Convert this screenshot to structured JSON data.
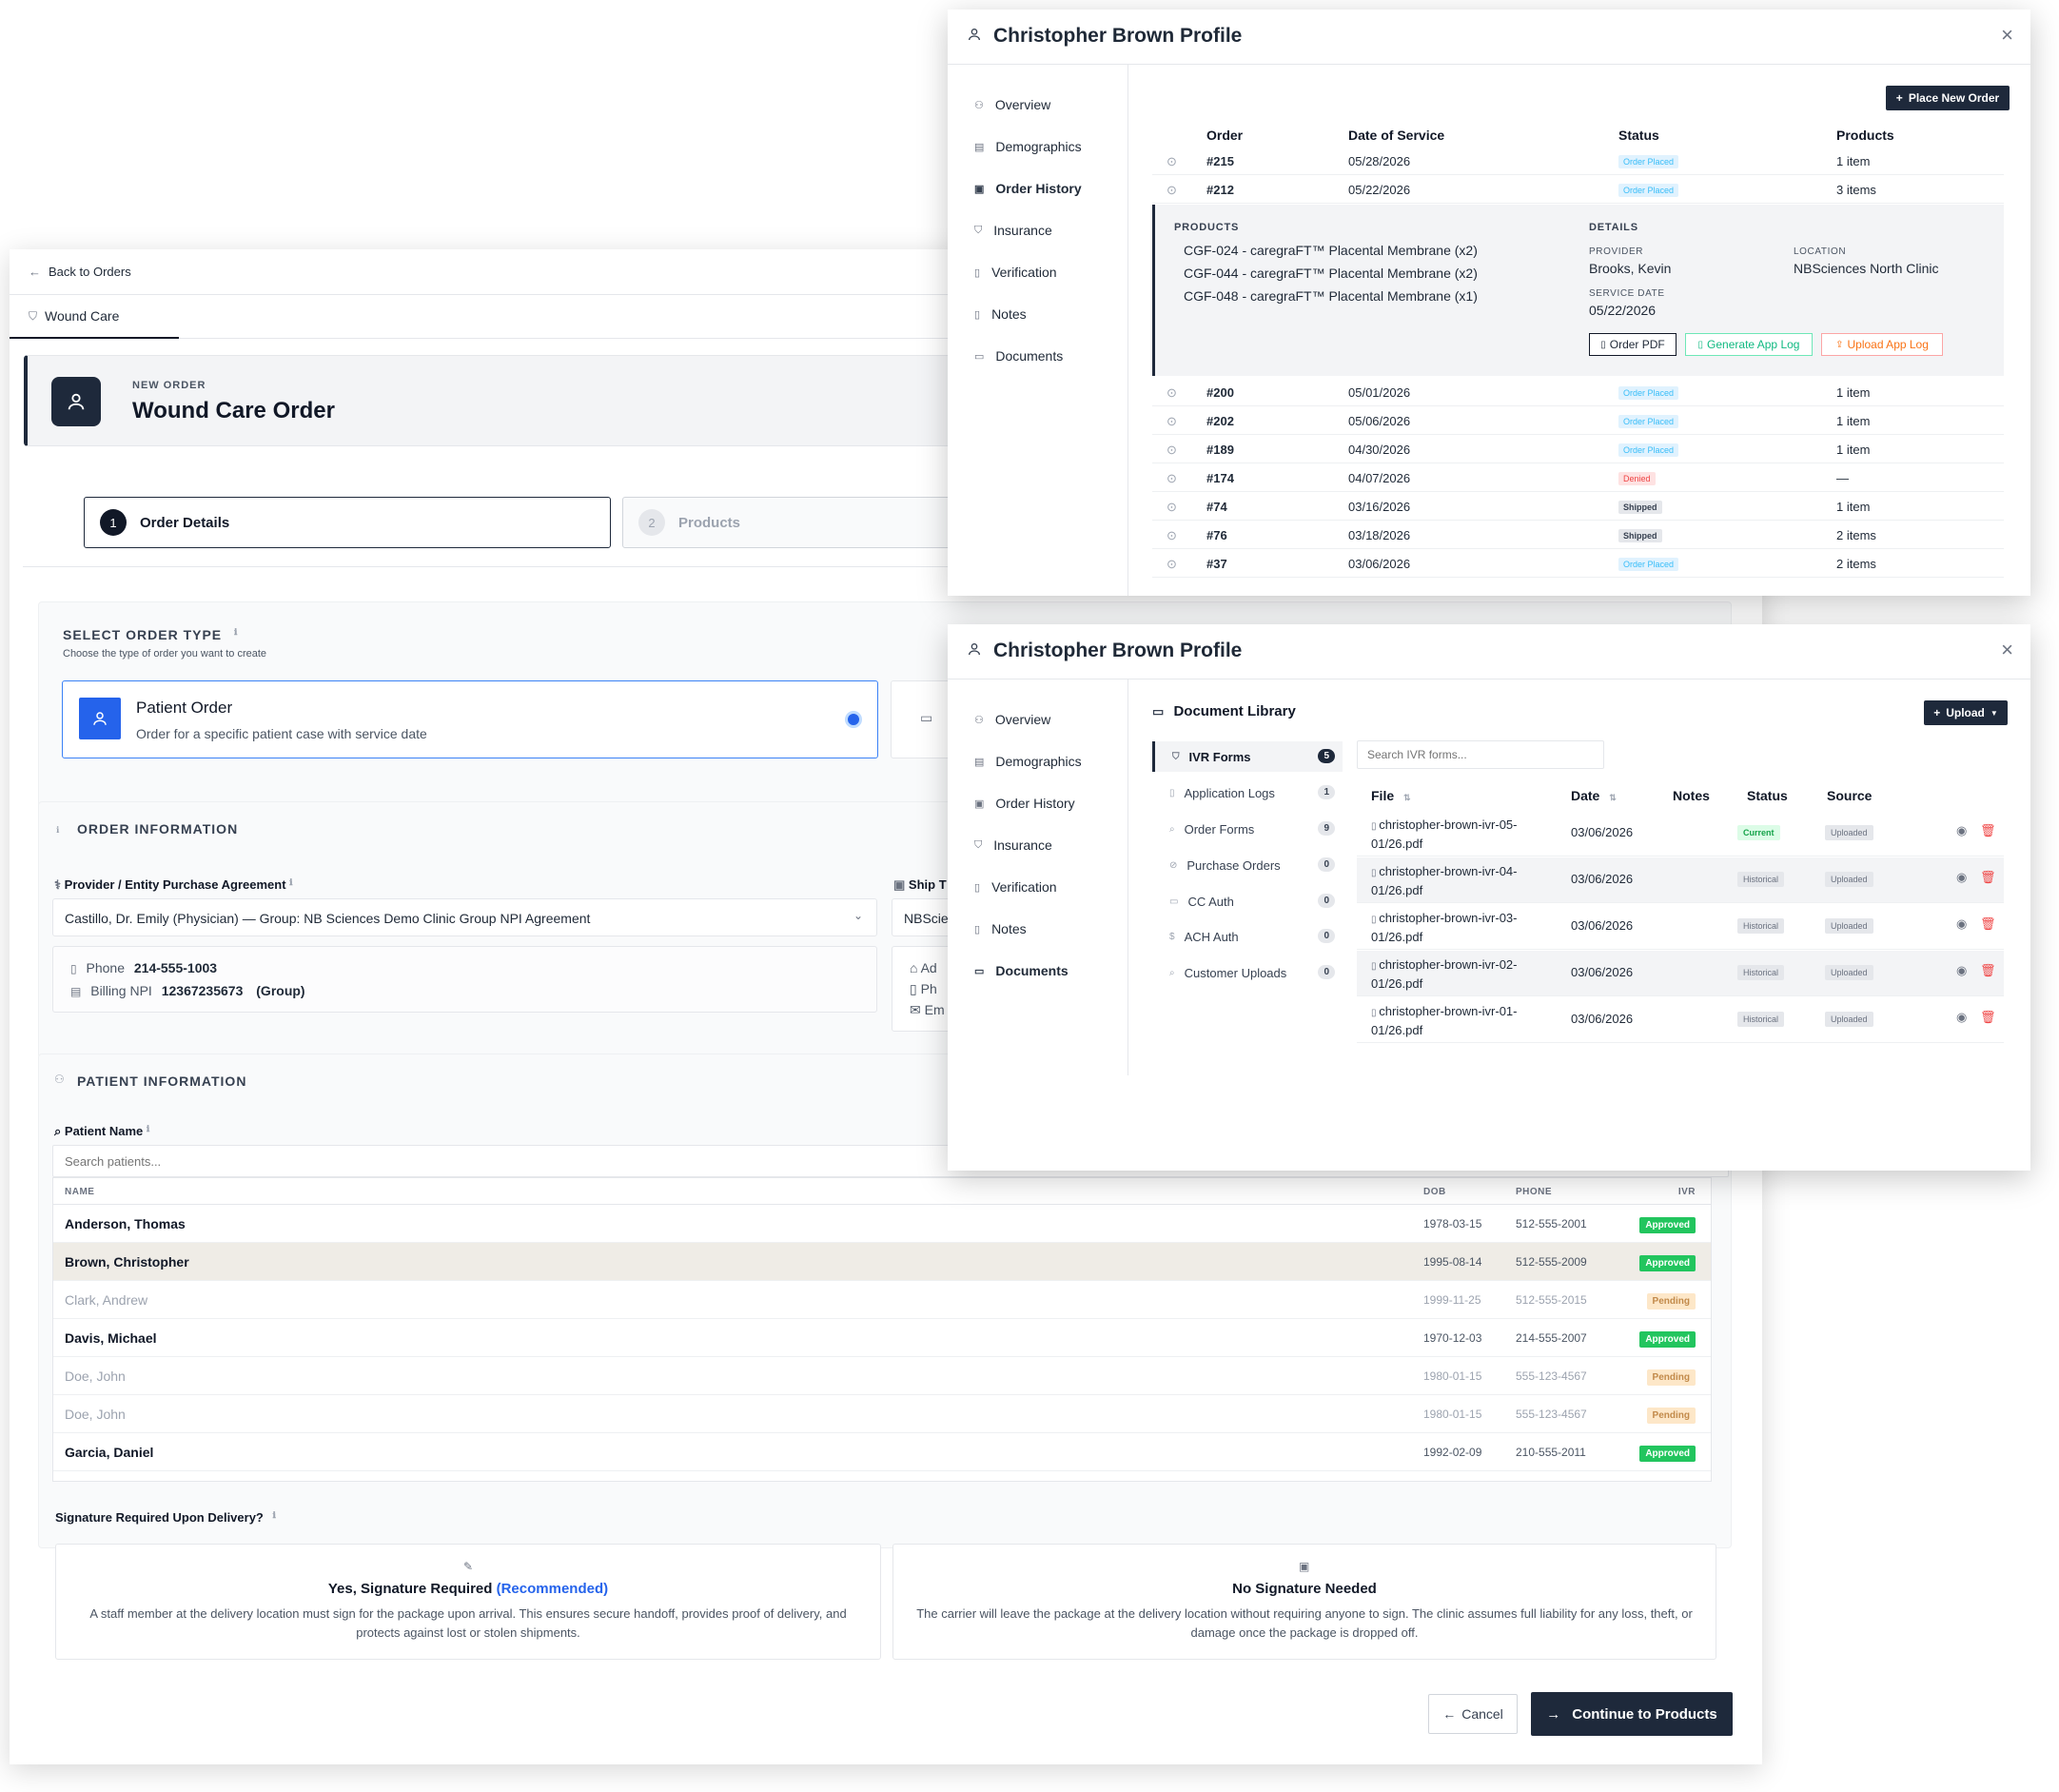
{
  "order_page": {
    "back_label": "Back to Orders",
    "tab_label": "Wound Care",
    "hero": {
      "kicker": "NEW ORDER",
      "title": "Wound Care Order"
    },
    "steps": [
      {
        "num": "1",
        "label": "Order Details"
      },
      {
        "num": "2",
        "label": "Products"
      }
    ],
    "order_type": {
      "heading": "SELECT ORDER TYPE",
      "info": "ℹ",
      "subtitle": "Choose the type of order you want to create",
      "patient_card": {
        "title": "Patient Order",
        "desc": "Order for a specific patient case with service date"
      }
    },
    "order_info": {
      "heading": "ORDER INFORMATION",
      "agreement_label": "Provider / Entity Purchase Agreement",
      "agreement_value": "Castillo, Dr. Emily (Physician) — Group: NB Sciences Demo Clinic Group NPI Agreement",
      "phone_label": "Phone",
      "phone_value": "214-555-1003",
      "npi_label": "Billing NPI",
      "npi_value": "12367235673",
      "npi_type": "(Group)",
      "ship_label": "Ship T",
      "ship_value": "NBScie",
      "ship_lines": [
        "Ad",
        "Ph",
        "Em"
      ]
    },
    "patient_info": {
      "heading": "PATIENT INFORMATION",
      "name_label": "Patient Name",
      "search_placeholder": "Search patients...",
      "columns": {
        "name": "NAME",
        "dob": "DOB",
        "phone": "PHONE",
        "ivr": "IVR"
      },
      "rows": [
        {
          "name": "Anderson, Thomas",
          "dob": "1978-03-15",
          "phone": "512-555-2001",
          "ivr": "Approved"
        },
        {
          "name": "Brown, Christopher",
          "dob": "1995-08-14",
          "phone": "512-555-2009",
          "ivr": "Approved"
        },
        {
          "name": "Clark, Andrew",
          "dob": "1999-11-25",
          "phone": "512-555-2015",
          "ivr": "Pending"
        },
        {
          "name": "Davis, Michael",
          "dob": "1970-12-03",
          "phone": "214-555-2007",
          "ivr": "Approved"
        },
        {
          "name": "Doe, John",
          "dob": "1980-01-15",
          "phone": "555-123-4567",
          "ivr": "Pending"
        },
        {
          "name": "Doe, John",
          "dob": "1980-01-15",
          "phone": "555-123-4567",
          "ivr": "Pending"
        },
        {
          "name": "Garcia, Daniel",
          "dob": "1992-02-09",
          "phone": "210-555-2011",
          "ivr": "Approved"
        }
      ]
    },
    "signature": {
      "question": "Signature Required Upon Delivery?",
      "yes_title": "Yes, Signature Required",
      "yes_tag": "(Recommended)",
      "yes_body": "A staff member at the delivery location must sign for the package upon arrival. This ensures secure handoff, provides proof of delivery, and protects against lost or stolen shipments.",
      "no_title": "No Signature Needed",
      "no_body": "The carrier will leave the package at the delivery location without requiring anyone to sign. The clinic assumes full liability for any loss, theft, or damage once the package is dropped off."
    },
    "actions": {
      "cancel": "Cancel",
      "continue": "Continue to Products"
    }
  },
  "profile_orders": {
    "title": "Christopher Brown Profile",
    "nav": [
      "Overview",
      "Demographics",
      "Order History",
      "Insurance",
      "Verification",
      "Notes",
      "Documents"
    ],
    "place_order": "Place New Order",
    "columns": {
      "order": "Order",
      "date": "Date of Service",
      "status": "Status",
      "products": "Products"
    },
    "rows_top": [
      {
        "order": "#215",
        "date": "05/28/2026",
        "status": "Order Placed",
        "products": "1 item"
      },
      {
        "order": "#212",
        "date": "05/22/2026",
        "status": "Order Placed",
        "products": "3 items"
      }
    ],
    "expanded": {
      "products_label": "PRODUCTS",
      "products": [
        "CGF-024 - caregraFT™ Placental Membrane (x2)",
        "CGF-044 - caregraFT™ Placental Membrane (x2)",
        "CGF-048 - caregraFT™ Placental Membrane (x1)"
      ],
      "details_label": "DETAILS",
      "provider_label": "PROVIDER",
      "provider": "Brooks, Kevin",
      "location_label": "LOCATION",
      "location": "NBSciences North Clinic",
      "service_date_label": "SERVICE DATE",
      "service_date": "05/22/2026",
      "btn_pdf": "Order PDF",
      "btn_gen": "Generate App Log",
      "btn_upload": "Upload App Log"
    },
    "rows_bottom": [
      {
        "order": "#200",
        "date": "05/01/2026",
        "status": "Order Placed",
        "products": "1 item"
      },
      {
        "order": "#202",
        "date": "05/06/2026",
        "status": "Order Placed",
        "products": "1 item"
      },
      {
        "order": "#189",
        "date": "04/30/2026",
        "status": "Order Placed",
        "products": "1 item"
      },
      {
        "order": "#174",
        "date": "04/07/2026",
        "status": "Denied",
        "products": "—"
      },
      {
        "order": "#74",
        "date": "03/16/2026",
        "status": "Shipped",
        "products": "1 item"
      },
      {
        "order": "#76",
        "date": "03/18/2026",
        "status": "Shipped",
        "products": "2 items"
      },
      {
        "order": "#37",
        "date": "03/06/2026",
        "status": "Order Placed",
        "products": "2 items"
      }
    ]
  },
  "profile_docs": {
    "title": "Christopher Brown Profile",
    "library_title": "Document Library",
    "upload": "Upload",
    "search_placeholder": "Search IVR forms...",
    "categories": [
      {
        "label": "IVR Forms",
        "count": "5"
      },
      {
        "label": "Application Logs",
        "count": "1"
      },
      {
        "label": "Order Forms",
        "count": "9"
      },
      {
        "label": "Purchase Orders",
        "count": "0"
      },
      {
        "label": "CC Auth",
        "count": "0"
      },
      {
        "label": "ACH Auth",
        "count": "0"
      },
      {
        "label": "Customer Uploads",
        "count": "0"
      }
    ],
    "columns": {
      "file": "File",
      "date": "Date",
      "notes": "Notes",
      "status": "Status",
      "source": "Source"
    },
    "files": [
      {
        "file": "christopher-brown-ivr-05-01/26.pdf",
        "date": "03/06/2026",
        "status": "Current",
        "source": "Uploaded"
      },
      {
        "file": "christopher-brown-ivr-04-01/26.pdf",
        "date": "03/06/2026",
        "status": "Historical",
        "source": "Uploaded"
      },
      {
        "file": "christopher-brown-ivr-03-01/26.pdf",
        "date": "03/06/2026",
        "status": "Historical",
        "source": "Uploaded"
      },
      {
        "file": "christopher-brown-ivr-02-01/26.pdf",
        "date": "03/06/2026",
        "status": "Historical",
        "source": "Uploaded"
      },
      {
        "file": "christopher-brown-ivr-01-01/26.pdf",
        "date": "03/06/2026",
        "status": "Historical",
        "source": "Uploaded"
      }
    ]
  }
}
